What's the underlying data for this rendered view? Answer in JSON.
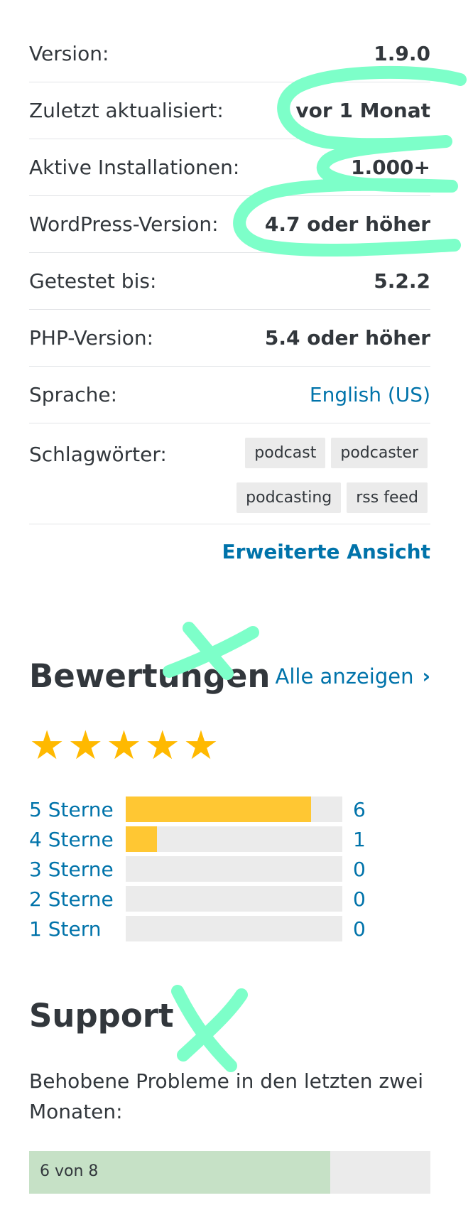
{
  "meta": {
    "rows": [
      {
        "label": "Version:",
        "value": "1.9.0"
      },
      {
        "label": "Zuletzt aktualisiert:",
        "value": "vor 1 Monat"
      },
      {
        "label": "Aktive Installationen:",
        "value": "1.000+"
      },
      {
        "label": "WordPress-Version:",
        "value": "4.7 oder höher"
      },
      {
        "label": "Getestet bis:",
        "value": "5.2.2"
      },
      {
        "label": "PHP-Version:",
        "value": "5.4 oder höher"
      }
    ],
    "language": {
      "label": "Sprache:",
      "value": "English (US)"
    },
    "tags": {
      "label": "Schlagwörter:",
      "items": [
        "podcast",
        "podcaster",
        "podcasting",
        "rss feed"
      ]
    },
    "advanced_link": "Erweiterte Ansicht"
  },
  "ratings": {
    "title": "Bewertungen",
    "see_all": "Alle anzeigen",
    "average_stars": 5,
    "bars": [
      {
        "label": "5 Sterne",
        "count": "6",
        "fraction": 0.857
      },
      {
        "label": "4 Sterne",
        "count": "1",
        "fraction": 0.143
      },
      {
        "label": "3 Sterne",
        "count": "0",
        "fraction": 0
      },
      {
        "label": "2 Sterne",
        "count": "0",
        "fraction": 0
      },
      {
        "label": "1 Stern",
        "count": "0",
        "fraction": 0
      }
    ]
  },
  "support": {
    "title": "Support",
    "text": "Behobene Probleme in den letzten zwei Monaten:",
    "resolved_label": "6 von 8",
    "resolved_fraction": 0.75
  },
  "colors": {
    "link": "#0073aa",
    "star": "#ffb900",
    "bar": "#ffc733",
    "resolved": "#c6e1c6",
    "annotation": "#7dffc9"
  }
}
